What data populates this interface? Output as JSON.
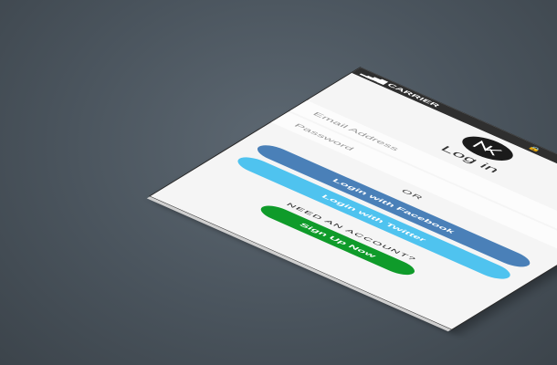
{
  "status_bar": {
    "carrier": "CARRIER",
    "signal_icon": "signal-bars-icon",
    "lock_icon": "lock-icon",
    "battery_icon": "battery-icon"
  },
  "header": {
    "logo_icon": "brand-logo-icon",
    "title": "Log in"
  },
  "form": {
    "email_placeholder": "Email Address",
    "password_placeholder": "Password",
    "separator": "OR"
  },
  "social": {
    "facebook_label": "Login with Facebook",
    "twitter_label": "Login with Twitter"
  },
  "signup": {
    "prompt": "NEED AN ACCOUNT?",
    "button_label": "Sign Up Now"
  },
  "colors": {
    "facebook": "#4a80b8",
    "twitter": "#4fc3ef",
    "signup": "#0f9b2a",
    "status_bar": "#2f2f2f"
  }
}
